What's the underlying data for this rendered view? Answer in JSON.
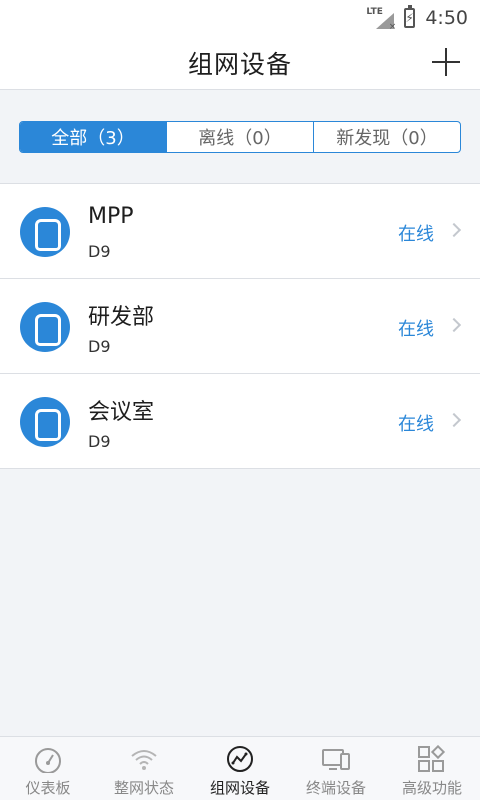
{
  "status_bar": {
    "network": "LTE",
    "time": "4:50"
  },
  "header": {
    "title": "组网设备",
    "add_icon": "plus-icon"
  },
  "filter_tabs": [
    {
      "label": "全部（3）",
      "active": true
    },
    {
      "label": "离线（0）",
      "active": false
    },
    {
      "label": "新发现（0）",
      "active": false
    }
  ],
  "devices": [
    {
      "name": "MPP",
      "model": "D9",
      "status": "在线"
    },
    {
      "name": "研发部",
      "model": "D9",
      "status": "在线"
    },
    {
      "name": "会议室",
      "model": "D9",
      "status": "在线"
    }
  ],
  "tab_bar": [
    {
      "label": "仪表板",
      "icon": "dashboard-icon",
      "active": false
    },
    {
      "label": "整网状态",
      "icon": "wifi-icon",
      "active": false
    },
    {
      "label": "组网设备",
      "icon": "network-devices-icon",
      "active": true
    },
    {
      "label": "终端设备",
      "icon": "terminal-devices-icon",
      "active": false
    },
    {
      "label": "高级功能",
      "icon": "advanced-functions-icon",
      "active": false
    }
  ],
  "colors": {
    "accent": "#2b87d8",
    "background": "#f2f4f7"
  }
}
